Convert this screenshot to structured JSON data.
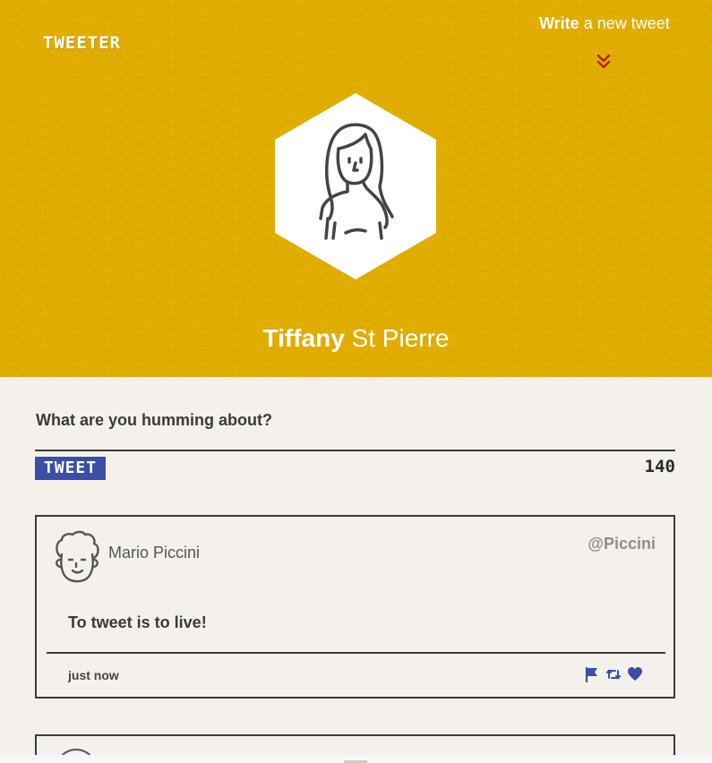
{
  "nav": {
    "logo": "TWEETER",
    "compose_link_bold": "Write",
    "compose_link_rest": " a new tweet"
  },
  "profile": {
    "first_name": "Tiffany",
    "last_name": " St Pierre"
  },
  "composer": {
    "prompt": "What are you humming about?",
    "submit_label": "TWEET",
    "char_count": "140"
  },
  "tweets": [
    {
      "author": "Mario Piccini",
      "handle": "@Piccini",
      "text": "To tweet is to live!",
      "time": "just now",
      "actions": [
        "flag-icon",
        "retweet-icon",
        "heart-icon"
      ]
    }
  ],
  "colors": {
    "header_bg": "#e2ae00",
    "page_bg": "#f4f1ec",
    "accent_blue": "#3b4fa6",
    "chevron_red": "#c0392b"
  }
}
